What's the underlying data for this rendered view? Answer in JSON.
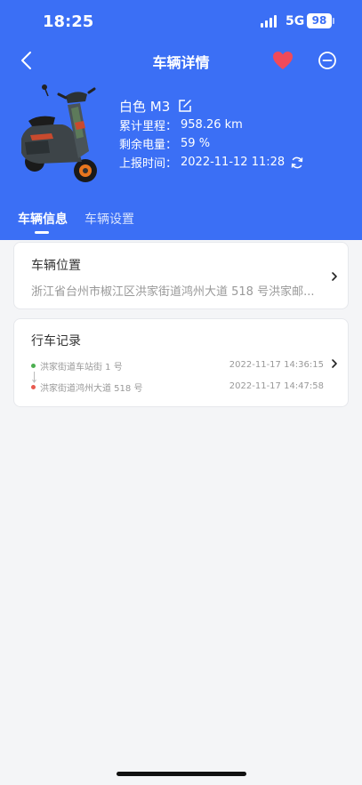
{
  "status": {
    "time": "18:25",
    "network": "5G",
    "battery": "98"
  },
  "header": {
    "title": "车辆详情",
    "colors": {
      "primary": "#3b6ff5",
      "heart": "#f04a5a"
    }
  },
  "vehicle": {
    "name": "白色 M3",
    "mileage_label": "累计里程：",
    "mileage": "958.26 km",
    "battery_label": "剩余电量：",
    "battery": "59 %",
    "report_label": "上报时间：",
    "report_time": "2022-11-12 11:28"
  },
  "tabs": [
    {
      "label": "车辆信息",
      "active": true
    },
    {
      "label": "车辆设置",
      "active": false
    }
  ],
  "location": {
    "title": "车辆位置",
    "address": "浙江省台州市椒江区洪家街道鸿州大道 518 号洪家邮..."
  },
  "trips": {
    "title": "行车记录",
    "start_place": "洪家街道车站街 1 号",
    "start_time": "2022-11-17 14:36:15",
    "end_place": "洪家街道鸿州大道 518 号",
    "end_time": "2022-11-17 14:47:58",
    "start_color": "#4caf50",
    "end_color": "#e85a4f"
  }
}
